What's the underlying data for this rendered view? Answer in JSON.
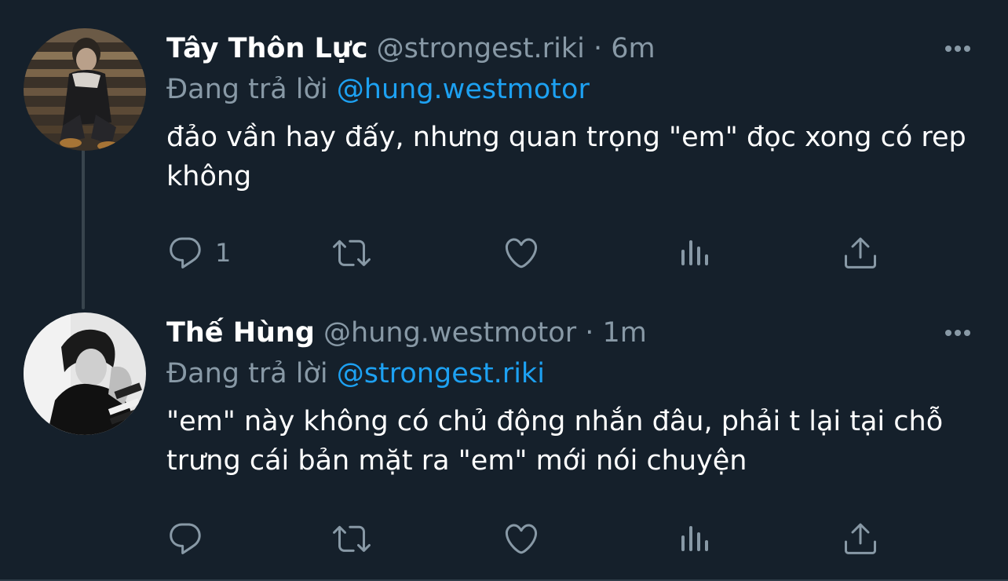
{
  "tweets": [
    {
      "display_name": "Tây Thôn Lực",
      "handle": "@strongest.riki",
      "separator": "·",
      "time": "6m",
      "reply_prefix": "Đang trả lời",
      "reply_to": "@hung.westmotor",
      "body": "đảo vần hay đấy, nhưng quan trọng \"em\" đọc xong có rep không",
      "reply_count": "1",
      "avatar_icon": "avatar-photo-dark"
    },
    {
      "display_name": "Thế Hùng",
      "handle": "@hung.westmotor",
      "separator": "·",
      "time": "1m",
      "reply_prefix": "Đang trả lời",
      "reply_to": "@strongest.riki",
      "body": "\"em\" này không có chủ động nhắn đâu, phải t lại tại chỗ trưng cái bản mặt ra \"em\" mới nói chuyện",
      "reply_count": "",
      "avatar_icon": "avatar-photo-grayscale"
    }
  ],
  "icons": {
    "more": "more-horizontal-icon",
    "reply": "reply-bubble-icon",
    "retweet": "retweet-icon",
    "like": "heart-icon",
    "analytics": "analytics-bars-icon",
    "share": "share-upload-icon"
  },
  "colors": {
    "background": "#15202b",
    "primary_text": "#ffffff",
    "secondary_text": "#8899a6",
    "accent": "#1da1f2",
    "thread_line": "#38444d"
  }
}
